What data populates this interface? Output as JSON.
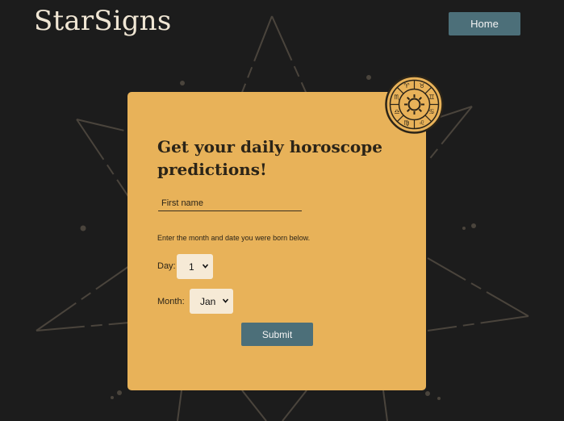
{
  "header": {
    "logo_text": "StarSigns",
    "home_label": "Home"
  },
  "form": {
    "title": "Get your daily horoscope predictions!",
    "first_name_placeholder": "First name",
    "instructions": "Enter the month and date you were born below.",
    "day_label": "Day:",
    "day_value": "1",
    "month_label": "Month:",
    "month_value": "Jan",
    "submit_label": "Submit"
  },
  "colors": {
    "background": "#1c1c1c",
    "card": "#e8b259",
    "button": "#4c6f79",
    "logo": "#f0e6d4"
  },
  "icons": {
    "zodiac_wheel": "zodiac-wheel-icon",
    "dropdown": "chevron-down-icon"
  }
}
